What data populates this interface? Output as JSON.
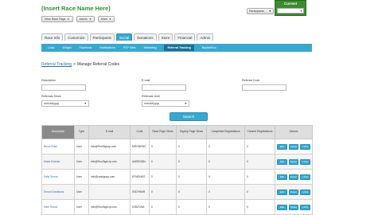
{
  "header": {
    "race_title": "(Insert Race Name Here)",
    "view_race_page": "View Race Page",
    "admin_menu": "Admin",
    "more_menu": "More",
    "current_label": "Current",
    "participants_label": "Participants"
  },
  "tabs": [
    "Race Info",
    "Customize",
    "Participants",
    "Social",
    "Donations",
    "Store",
    "Financial",
    "Admin"
  ],
  "active_tab": "Social",
  "subnav": [
    "Links",
    "Widget",
    "Facebook",
    "Notifications",
    "P2P Sites",
    "Marketing",
    "Referral Tracking",
    "BuyMeRun"
  ],
  "active_subnav": "Referral Tracking",
  "breadcrumb": {
    "link": "Referral Tracking",
    "separator": ">",
    "current": "Manage Referral Codes"
  },
  "form": {
    "description_label": "Description",
    "email_label": "E-mail",
    "referral_code_label": "Referral Code",
    "referrals_since_label": "Referrals Since",
    "referrals_until_label": "Referrals Until",
    "date_placeholder": "mm/dd/yyyy",
    "search_button": "Search"
  },
  "table": {
    "columns": [
      "Description",
      "Type",
      "E-mail",
      "Code",
      "Race Page Views",
      "SignUp Page Views",
      "Completed Registrations",
      "Cleared Registrations",
      "Actions"
    ],
    "rows": [
      {
        "description": "Bruce Bush",
        "type": "User",
        "email": "info@RunSignup.com",
        "code": "MRGBXWC",
        "race_views": "0",
        "signup_views": "0",
        "completed": "0",
        "cleared": "0"
      },
      {
        "description": "Maria Estrella",
        "type": "User",
        "email": "info@RunSignUp.com",
        "code": "AMSRGBN",
        "race_views": "0",
        "signup_views": "0",
        "completed": "0",
        "cleared": "0"
      },
      {
        "description": "Sally Smoot",
        "type": "User",
        "email": "info@runsignup.com",
        "code": "EFMDNKG",
        "race_views": "0",
        "signup_views": "0",
        "completed": "0",
        "cleared": "0"
      },
      {
        "description": "Smoot Donations",
        "type": "User",
        "email": "",
        "code": "SSDYNNR",
        "race_views": "0",
        "signup_views": "0",
        "completed": "0",
        "cleared": "0"
      },
      {
        "description": "Sam Smoot",
        "type": "User",
        "email": "info@RunSignUp.com",
        "code": "KZBZYAM",
        "race_views": "0",
        "signup_views": "0",
        "completed": "0",
        "cleared": "0"
      }
    ],
    "actions": [
      "Edit",
      "Reset",
      "Links"
    ]
  },
  "colors": {
    "brand_green": "#3d8b2f",
    "accent_blue": "#3aa7cf",
    "link_blue": "#2a72a8"
  }
}
